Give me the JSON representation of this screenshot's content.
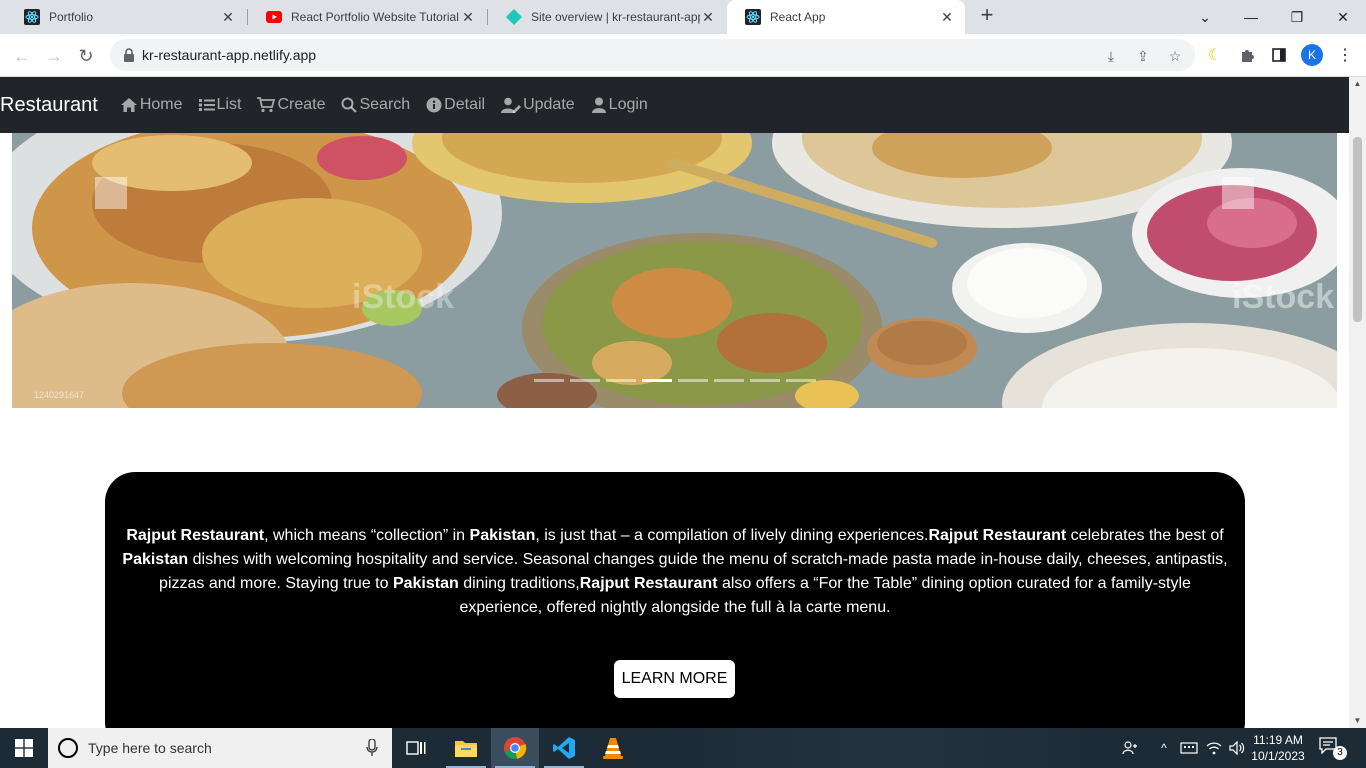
{
  "browser": {
    "tabs": [
      {
        "title": "Portfolio",
        "icon": "react-icon"
      },
      {
        "title": "React Portfolio Website Tutorial",
        "icon": "youtube-icon"
      },
      {
        "title": "Site overview | kr-restaurant-app",
        "icon": "netlify-icon"
      },
      {
        "title": "React App",
        "icon": "react-icon"
      }
    ],
    "active_tab": 3,
    "url": "kr-restaurant-app.netlify.app",
    "profile_initial": "K"
  },
  "app": {
    "brand": "Restaurant",
    "nav": [
      {
        "label": "Home",
        "icon": "home-icon"
      },
      {
        "label": "List",
        "icon": "list-icon"
      },
      {
        "label": "Create",
        "icon": "cart-icon"
      },
      {
        "label": "Search",
        "icon": "search-icon"
      },
      {
        "label": "Detail",
        "icon": "info-icon"
      },
      {
        "label": "Update",
        "icon": "user-edit-icon"
      },
      {
        "label": "Login",
        "icon": "user-icon"
      }
    ],
    "carousel": {
      "slide_count": 8,
      "active_index": 3,
      "watermark": "iStock",
      "image_code": "1240291647"
    },
    "about": {
      "segments": [
        {
          "text": "Rajput Restaurant",
          "bold": true
        },
        {
          "text": ", which means “collection” in ",
          "bold": false
        },
        {
          "text": "Pakistan",
          "bold": true
        },
        {
          "text": ", is just that – a compilation of lively dining experiences.",
          "bold": false
        },
        {
          "text": "Rajput Restaurant",
          "bold": true
        },
        {
          "text": " celebrates the best of ",
          "bold": false
        },
        {
          "text": "Pakistan",
          "bold": true
        },
        {
          "text": " dishes with welcoming hospitality and service. Seasonal changes guide the menu of scratch-made pasta made in-house daily, cheeses, antipastis, pizzas and more. Staying true to ",
          "bold": false
        },
        {
          "text": "Pakistan",
          "bold": true
        },
        {
          "text": " dining traditions,",
          "bold": false
        },
        {
          "text": "Rajput Restaurant",
          "bold": true
        },
        {
          "text": " also offers a “For the Table” dining option curated for a family-style experience, offered nightly alongside the full à la carte menu.",
          "bold": false
        }
      ],
      "button_label": "LEARN MORE"
    }
  },
  "taskbar": {
    "search_placeholder": "Type here to search",
    "time": "11:19 AM",
    "date": "10/1/2023",
    "notification_count": "3"
  }
}
